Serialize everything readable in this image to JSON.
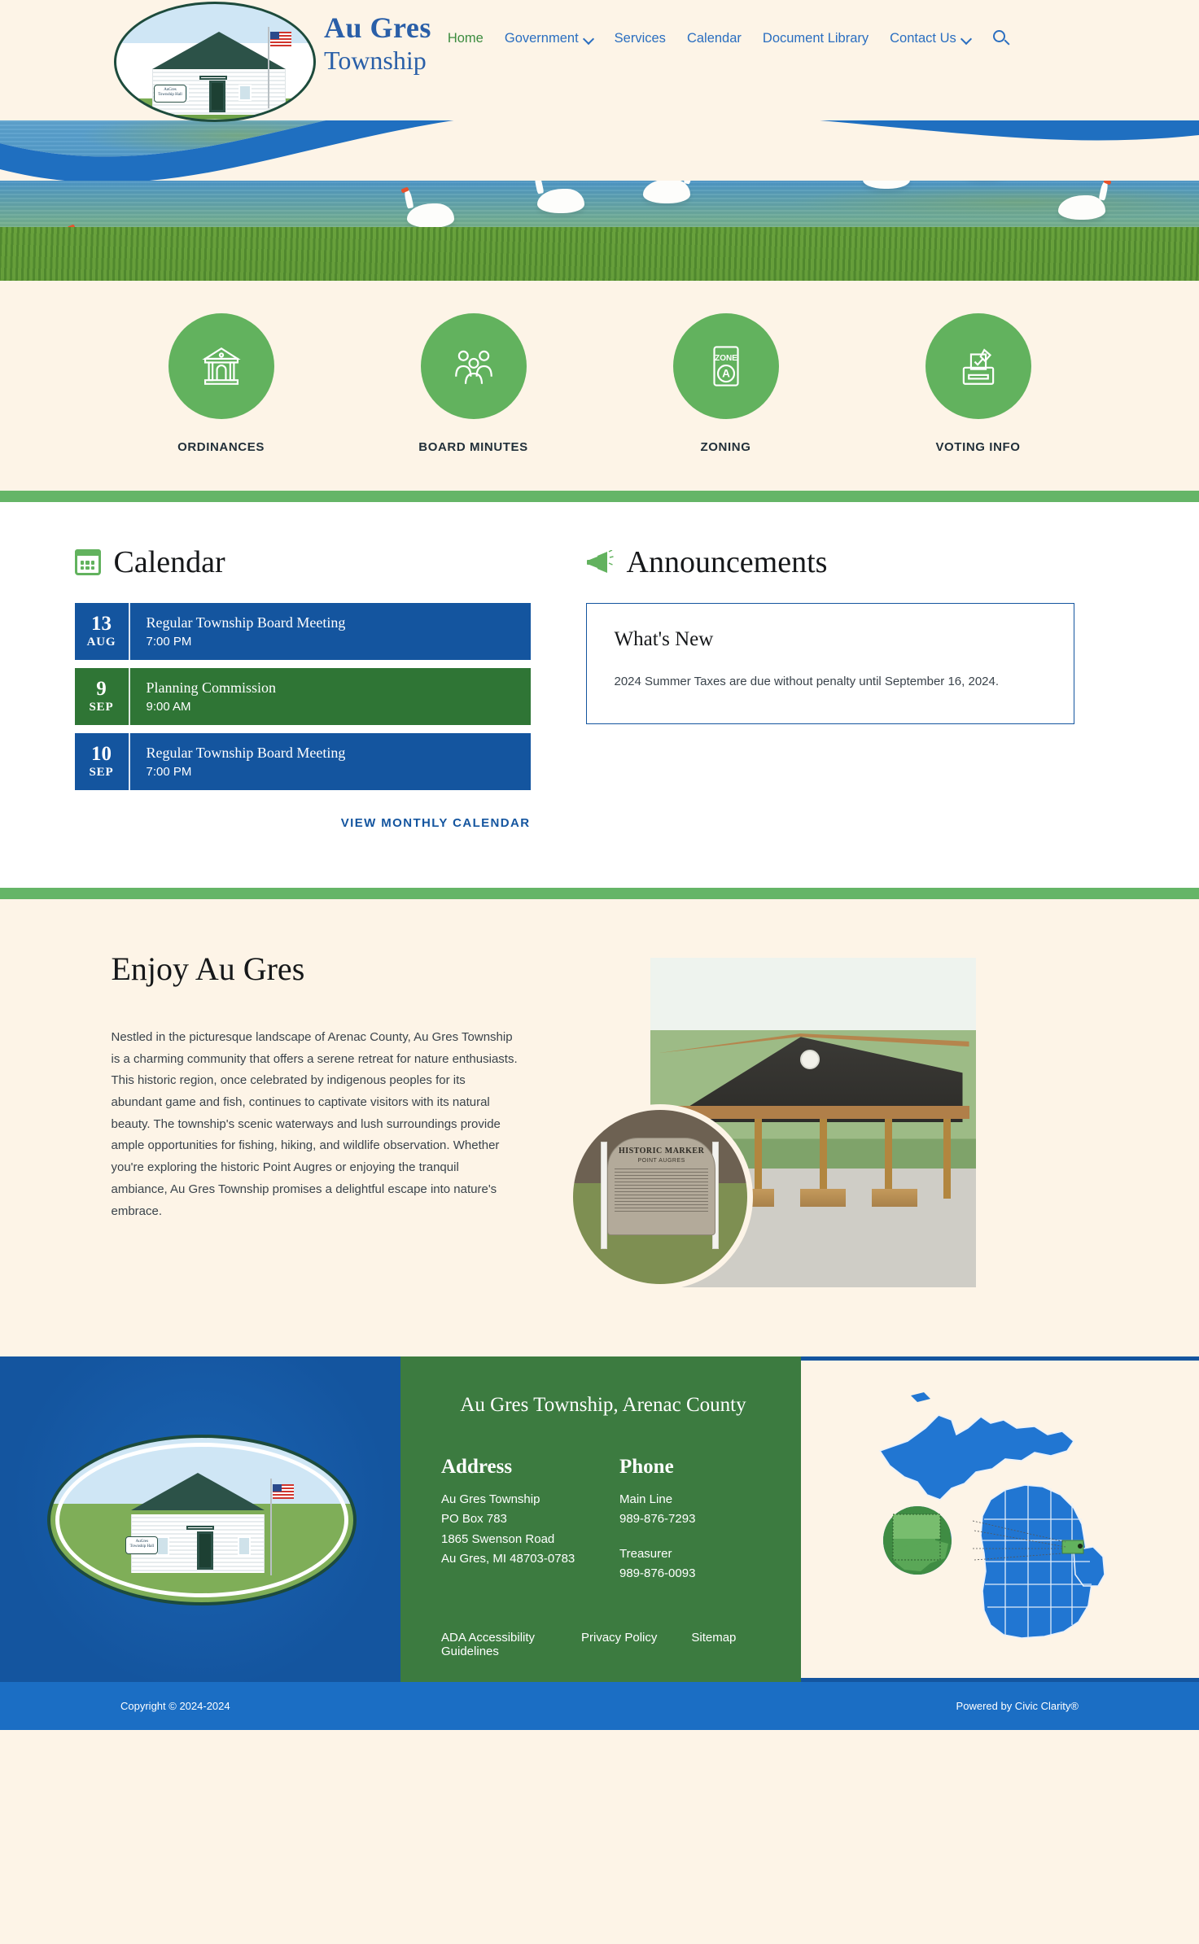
{
  "header": {
    "logo_alt": "Au Gres Township Hall",
    "logo_sign_line1": "AuGres",
    "logo_sign_line2": "Township Hall",
    "brand_line1": "Au Gres",
    "brand_line2": "Township",
    "nav": [
      {
        "label": "Home",
        "active": true,
        "dropdown": false
      },
      {
        "label": "Government",
        "active": false,
        "dropdown": true
      },
      {
        "label": "Services",
        "active": false,
        "dropdown": false
      },
      {
        "label": "Calendar",
        "active": false,
        "dropdown": false
      },
      {
        "label": "Document Library",
        "active": false,
        "dropdown": false
      },
      {
        "label": "Contact Us",
        "active": false,
        "dropdown": true
      }
    ],
    "search_icon": "search-icon"
  },
  "hero": {
    "alt": "Mute swans swimming in a marshy lake with green reeds"
  },
  "quick_links": [
    {
      "label": "ORDINANCES",
      "icon": "courthouse-icon"
    },
    {
      "label": "BOARD MINUTES",
      "icon": "people-group-icon"
    },
    {
      "label": "ZONING",
      "icon": "zone-sign-icon"
    },
    {
      "label": "VOTING INFO",
      "icon": "ballot-box-icon"
    }
  ],
  "calendar": {
    "icon": "calendar-icon",
    "heading": "Calendar",
    "events": [
      {
        "day": "13",
        "month": "AUG",
        "title": "Regular Township Board Meeting",
        "time": "7:00 PM",
        "color": "blue"
      },
      {
        "day": "9",
        "month": "SEP",
        "title": "Planning Commission",
        "time": "9:00 AM",
        "color": "green"
      },
      {
        "day": "10",
        "month": "SEP",
        "title": "Regular Township Board Meeting",
        "time": "7:00 PM",
        "color": "blue"
      }
    ],
    "link_label": "VIEW MONTHLY CALENDAR"
  },
  "announcements": {
    "icon": "megaphone-icon",
    "heading": "Announcements",
    "card": {
      "title": "What's New",
      "body": "2024 Summer Taxes are due without penalty until September 16, 2024."
    }
  },
  "enjoy": {
    "heading": "Enjoy Au Gres",
    "body": "Nestled in the picturesque landscape of Arenac County, Au Gres Township is a charming community that offers a serene retreat for nature enthusiasts. This historic region, once celebrated by indigenous peoples for its abundant game and fish, continues to captivate visitors with its natural beauty. The township's scenic waterways and lush surroundings provide ample opportunities for fishing, hiking, and wildlife observation. Whether you're exploring the historic Point Augres or enjoying the tranquil ambiance, Au Gres Township promises a delightful escape into nature's embrace.",
    "photo_alt": "Park pavilion with picnic tables",
    "marker_title": "HISTORIC MARKER",
    "marker_subtitle": "POINT AUGRES"
  },
  "footer": {
    "photo_alt": "Au Gres Township Hall building with American flag",
    "title": "Au Gres Township, Arenac County",
    "address": {
      "heading": "Address",
      "lines": [
        "Au Gres Township",
        "PO Box 783",
        "1865 Swenson Road",
        "Au Gres, MI 48703-0783"
      ]
    },
    "phone": {
      "heading": "Phone",
      "main_label": "Main Line",
      "main_number": "989-876-7293",
      "treasurer_label": "Treasurer",
      "treasurer_number": "989-876-0093"
    },
    "links": [
      {
        "label": "ADA Accessibility Guidelines"
      },
      {
        "label": "Privacy Policy"
      },
      {
        "label": "Sitemap"
      }
    ],
    "map_alt": "Map of Michigan counties with Arenac County highlighted"
  },
  "copyright": {
    "left": "Copyright © 2024-2024",
    "right": "Powered by Civic Clarity®"
  },
  "colors": {
    "cream": "#fdf4e7",
    "blue": "#14559f",
    "light_blue": "#1b6ec4",
    "green": "#62b25e",
    "dark_green": "#3c7b40",
    "nav_blue": "#2a6ec0",
    "nav_active_green": "#3c8c3f"
  }
}
